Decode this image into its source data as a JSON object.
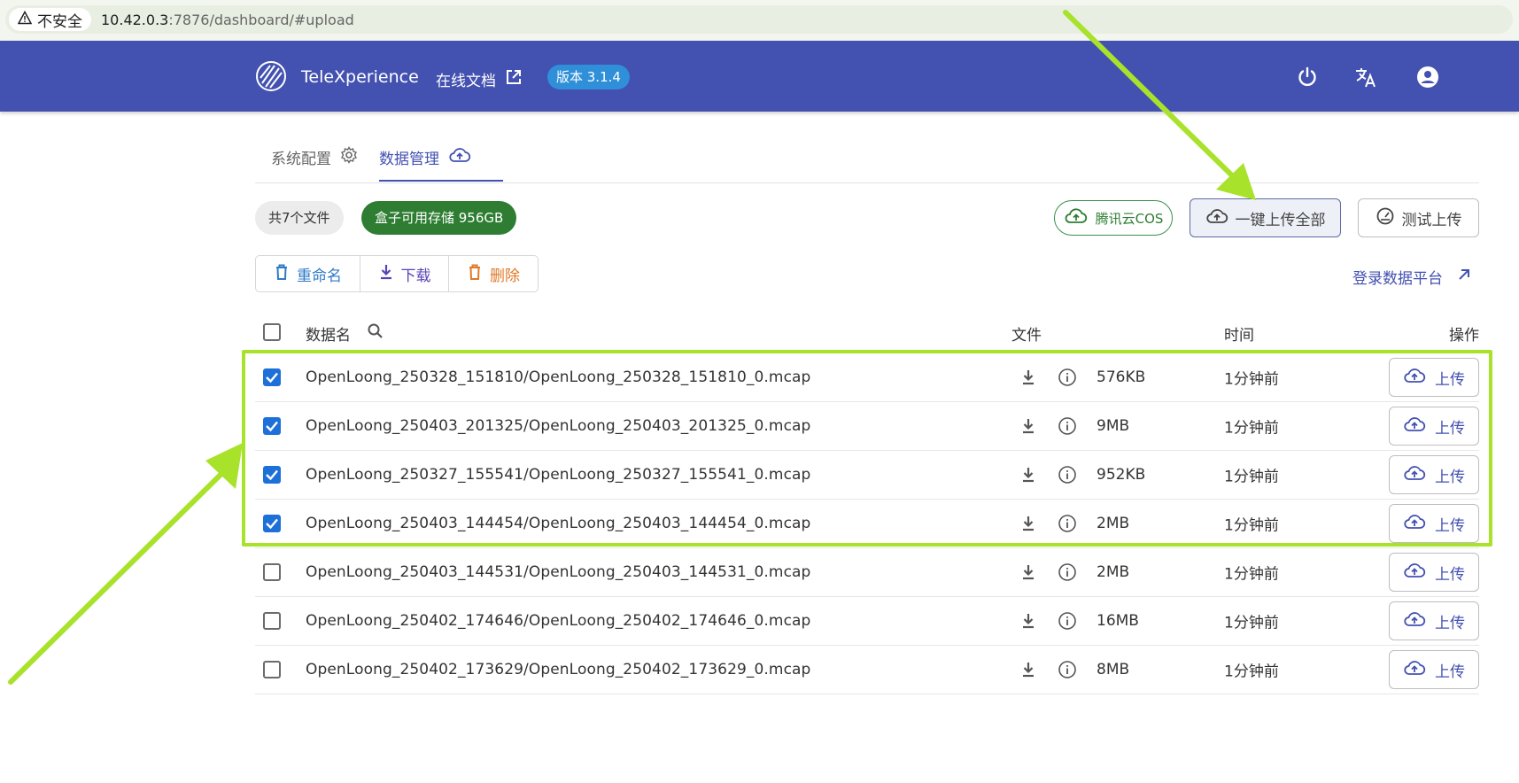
{
  "browser": {
    "insecure_label": "不安全",
    "url_host": "10.42.0.3",
    "url_rest": ":7876/dashboard/#upload"
  },
  "appbar": {
    "brand": "TeleXperience",
    "docs_label": "在线文档",
    "version_label": "版本 3.1.4",
    "bg_color": "#4351b1"
  },
  "tabs": [
    {
      "label": "系统配置",
      "icon": "gear-icon",
      "active": false
    },
    {
      "label": "数据管理",
      "icon": "cloud-upload-icon",
      "active": true
    }
  ],
  "summary": {
    "files_chip": "共7个文件",
    "storage_chip": "盒子可用存储 956GB"
  },
  "actions": {
    "cos_label": "腾讯云COS",
    "upload_all_label": "一键上传全部",
    "test_upload_label": "测试上传",
    "rename_label": "重命名",
    "download_label": "下载",
    "delete_label": "删除",
    "login_platform_label": "登录数据平台"
  },
  "table": {
    "headers": {
      "name": "数据名",
      "file": "文件",
      "time": "时间",
      "ops": "操作"
    },
    "upload_label": "上传",
    "rows": [
      {
        "name": "OpenLoong_250328_151810/OpenLoong_250328_151810_0.mcap",
        "size": "576KB",
        "time": "1分钟前",
        "checked": true
      },
      {
        "name": "OpenLoong_250403_201325/OpenLoong_250403_201325_0.mcap",
        "size": "9MB",
        "time": "1分钟前",
        "checked": true
      },
      {
        "name": "OpenLoong_250327_155541/OpenLoong_250327_155541_0.mcap",
        "size": "952KB",
        "time": "1分钟前",
        "checked": true
      },
      {
        "name": "OpenLoong_250403_144454/OpenLoong_250403_144454_0.mcap",
        "size": "2MB",
        "time": "1分钟前",
        "checked": true
      },
      {
        "name": "OpenLoong_250403_144531/OpenLoong_250403_144531_0.mcap",
        "size": "2MB",
        "time": "1分钟前",
        "checked": false
      },
      {
        "name": "OpenLoong_250402_174646/OpenLoong_250402_174646_0.mcap",
        "size": "16MB",
        "time": "1分钟前",
        "checked": false
      },
      {
        "name": "OpenLoong_250402_173629/OpenLoong_250402_173629_0.mcap",
        "size": "8MB",
        "time": "1分钟前",
        "checked": false
      }
    ]
  },
  "colors": {
    "primary": "#4351b1",
    "storage_chip": "#2e7d32",
    "annotation": "#a8e22b",
    "checkbox": "#1e70d9"
  }
}
